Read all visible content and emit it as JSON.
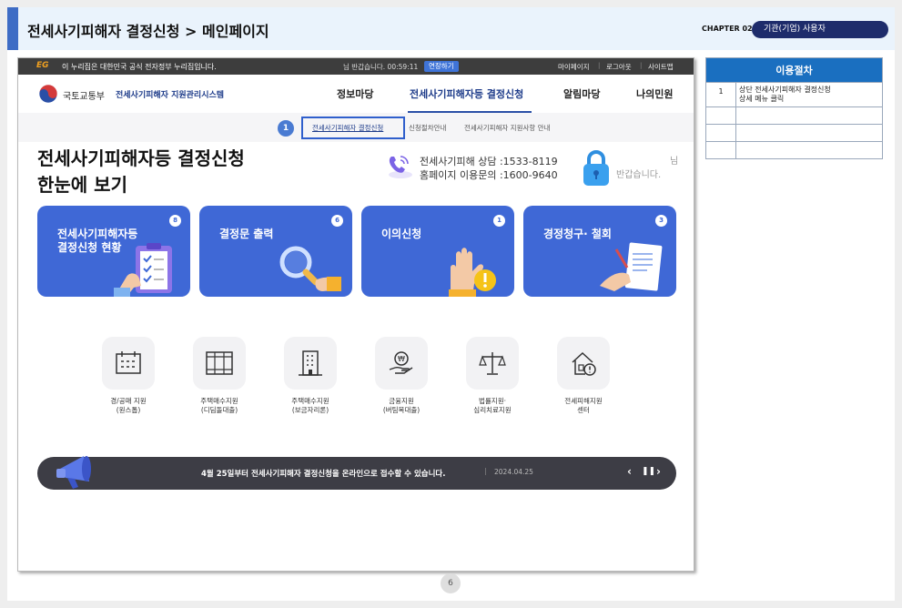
{
  "header": {
    "title": "전세사기피해자 결정신청 > 메인페이지",
    "chapter": "CHAPTER 02",
    "role_badge": "기관(기업) 사용자"
  },
  "site": {
    "topbar": {
      "logo_text": "EG",
      "gov_notice": "이 누리집은 대한민국 공식 전자정부 누리집입니다.",
      "session_text": "님 반갑습니다. 00:59:11",
      "extend_button": "연장하기",
      "links": [
        "마이페이지",
        "로그아웃",
        "사이트맵"
      ]
    },
    "brand": {
      "ministry": "국토교통부",
      "system_name": "전세사기피해자 지원관리시스템"
    },
    "nav": [
      "정보마당",
      "전세사기피해자등 결정신청",
      "알림마당",
      "나의민원"
    ],
    "nav_active": "전세사기피해자등 결정신청",
    "step_marker": "1",
    "subnav": [
      "전세사기피해자 결정신청",
      "신청절차안내",
      "전세사기피해자 지원사항 안내"
    ],
    "main_title_line1": "전세사기피해자등 결정신청",
    "main_title_line2": "한눈에 보기",
    "contact_line1": "전세사기피해 상담 :1533-8119",
    "contact_line2": "홈페이지 이용문의 :1600-9640",
    "greeting_nim": "님",
    "greeting": "반갑습니다.",
    "cards": [
      {
        "title_line1": "전세사기피해자등",
        "title_line2": "결정신청 현황",
        "count": "8"
      },
      {
        "title_line1": "결정문 출력",
        "title_line2": "",
        "count": "6"
      },
      {
        "title_line1": "이의신청",
        "title_line2": "",
        "count": "1"
      },
      {
        "title_line1": "경정청구· 철회",
        "title_line2": "",
        "count": "3"
      }
    ],
    "services": [
      {
        "label": "경/공매 지원\n(원스톱)",
        "icon": "calendar-icon"
      },
      {
        "label": "주택매수지원\n(디딤돌대출)",
        "icon": "window-icon"
      },
      {
        "label": "주택매수지원\n(보금자리론)",
        "icon": "building-icon"
      },
      {
        "label": "금융지원\n(버팀목대출)",
        "icon": "won-hand-icon"
      },
      {
        "label": "법률지원·\n심리치료지원",
        "icon": "scales-icon"
      },
      {
        "label": "전세피해지원\n센터",
        "icon": "house-alert-icon"
      }
    ],
    "notice": {
      "text": "4월 25일부터 전세사기피해자 결정신청을 온라인으로 접수할 수 있습니다.",
      "date": "2024.04.25"
    }
  },
  "procedure": {
    "header": "이용절차",
    "rows": [
      {
        "num": "1",
        "desc": "상단 전세사기피해자 결정신청\n상세 메뉴 클릭"
      },
      {
        "num": "",
        "desc": ""
      },
      {
        "num": "",
        "desc": ""
      },
      {
        "num": "",
        "desc": ""
      }
    ]
  },
  "page_number": "6",
  "colors": {
    "brand_blue": "#3f68d6",
    "navy": "#1e3c8a",
    "table_header": "#1a6fc0",
    "role_badge_bg": "#1e2c6b"
  }
}
